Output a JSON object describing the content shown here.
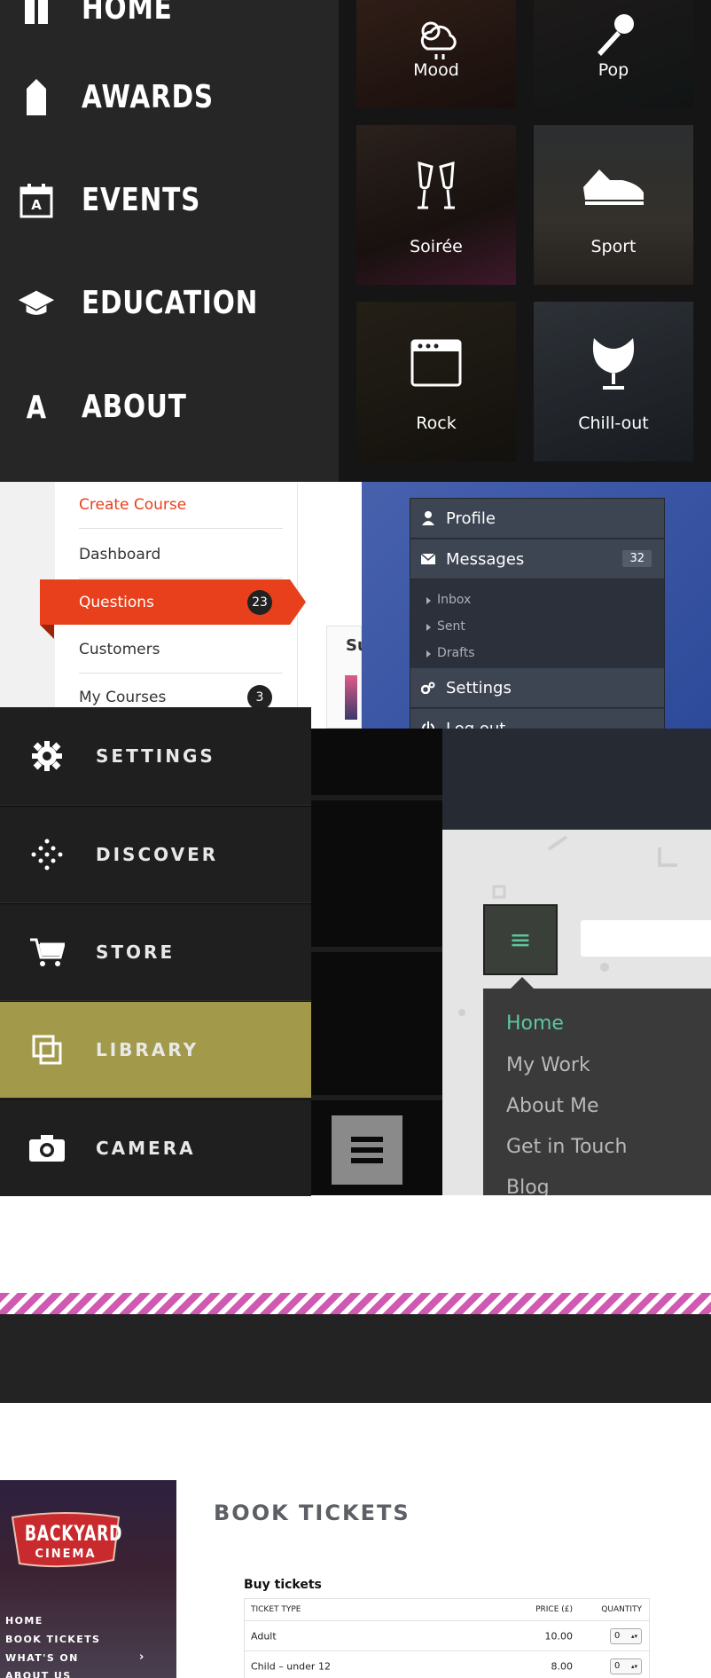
{
  "panel1": {
    "items": [
      {
        "label": "HOME",
        "icon": "home-icon"
      },
      {
        "label": "AWARDS",
        "icon": "award-tag-icon"
      },
      {
        "label": "EVENTS",
        "icon": "calendar-icon"
      },
      {
        "label": "EDUCATION",
        "icon": "graduation-cap-icon"
      },
      {
        "label": "ABOUT",
        "icon": "letter-a-icon"
      }
    ],
    "calendar_letter": "A",
    "about_letter": "A"
  },
  "panel2": {
    "tiles": [
      {
        "label": "Mood",
        "icon": "weather-icon"
      },
      {
        "label": "Pop",
        "icon": "microphone-icon"
      },
      {
        "label": "Soirée",
        "icon": "champagne-glasses-icon"
      },
      {
        "label": "Sport",
        "icon": "sneaker-icon"
      },
      {
        "label": "Rock",
        "icon": "amplifier-icon"
      },
      {
        "label": "Chill-out",
        "icon": "egg-chair-icon"
      }
    ]
  },
  "panel3": {
    "create": "Create Course",
    "items": [
      {
        "label": "Dashboard",
        "badge": ""
      },
      {
        "label": "Questions",
        "badge": "23"
      },
      {
        "label": "Customers",
        "badge": ""
      },
      {
        "label": "My Courses",
        "badge": "3"
      }
    ],
    "peek": "Su",
    "accent": "#e8401c"
  },
  "panel4": {
    "profile": "Profile",
    "messages": "Messages",
    "messages_count": "32",
    "sub": [
      "Inbox",
      "Sent",
      "Drafts"
    ],
    "settings": "Settings",
    "logout": "Log out"
  },
  "panel5": {
    "items": [
      {
        "label": "SETTINGS",
        "icon": "gear-icon"
      },
      {
        "label": "DISCOVER",
        "icon": "discover-dots-icon"
      },
      {
        "label": "STORE",
        "icon": "cart-icon"
      },
      {
        "label": "LIBRARY",
        "icon": "library-icon"
      },
      {
        "label": "CAMERA",
        "icon": "camera-icon"
      }
    ],
    "active_color": "#a29a4a"
  },
  "panel6": {
    "menu_glyph": "≡",
    "items": [
      "Home",
      "My Work",
      "About Me",
      "Get in Touch",
      "Blog"
    ],
    "active_color": "#5cc79c"
  },
  "cinema": {
    "logo_top": "BACKYARD",
    "logo_bottom": "CINEMA",
    "nav": [
      "HOME",
      "BOOK TICKETS",
      "WHAT'S ON",
      "ABOUT US"
    ],
    "nav_chevron": "›",
    "title": "BOOK TICKETS",
    "subtitle": "Buy tickets",
    "columns": [
      "TICKET TYPE",
      "PRICE (£)",
      "QUANTITY"
    ],
    "rows": [
      {
        "type": "Adult",
        "price": "10.00",
        "qty": "0"
      },
      {
        "type": "Child – under 12",
        "price": "8.00",
        "qty": "0"
      }
    ]
  }
}
